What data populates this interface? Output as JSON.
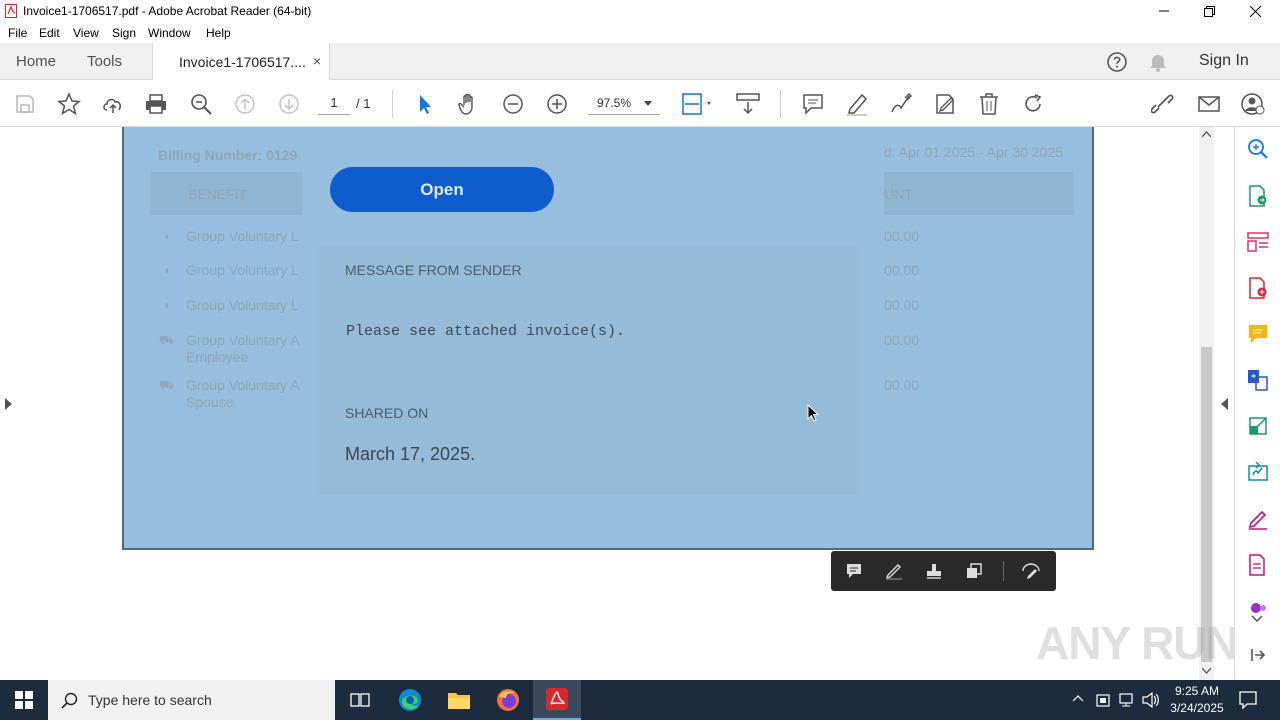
{
  "window": {
    "title": "Invoice1-1706517.pdf - Adobe Acrobat Reader (64-bit)"
  },
  "menu": [
    "File",
    "Edit",
    "View",
    "Sign",
    "Window",
    "Help"
  ],
  "tabs": {
    "home": "Home",
    "tools": "Tools",
    "document": "Invoice1-1706517....",
    "close": "×",
    "sign_in": "Sign In"
  },
  "toolbar": {
    "page_current": "1",
    "page_total": "/ 1",
    "zoom": "97.5%"
  },
  "document": {
    "billing_number": "Billing Number: 0129",
    "period": "d: Apr 01 2025 - Apr 30 2025",
    "col_benefit": "BENEFIT",
    "col_amount": "UNT",
    "rows": [
      {
        "benefit": "Group Voluntary L",
        "amount": "00.00"
      },
      {
        "benefit": "Group Voluntary L",
        "amount": "00.00"
      },
      {
        "benefit": "Group Voluntary L",
        "amount": "00.00"
      },
      {
        "benefit": "Group Voluntary A",
        "benefit2": "Employee",
        "amount": "00.00"
      },
      {
        "benefit": "Group Voluntary A",
        "benefit2": "Spouse",
        "amount": "00.00"
      }
    ]
  },
  "overlay": {
    "open_button": "Open",
    "message_heading": "MESSAGE FROM SENDER",
    "message_body": "Please see attached invoice(s).",
    "shared_heading": "SHARED ON",
    "shared_date": "March 17, 2025."
  },
  "taskbar": {
    "search_placeholder": "Type here to search",
    "time": "9:25 AM",
    "date": "3/24/2025"
  },
  "watermark": "ANY RUN",
  "colors": {
    "page_overlay": "#97bedc",
    "open_button": "#0f5ccc",
    "acrobat_red": "#d7282f",
    "taskbar": "#1c2c3e"
  }
}
